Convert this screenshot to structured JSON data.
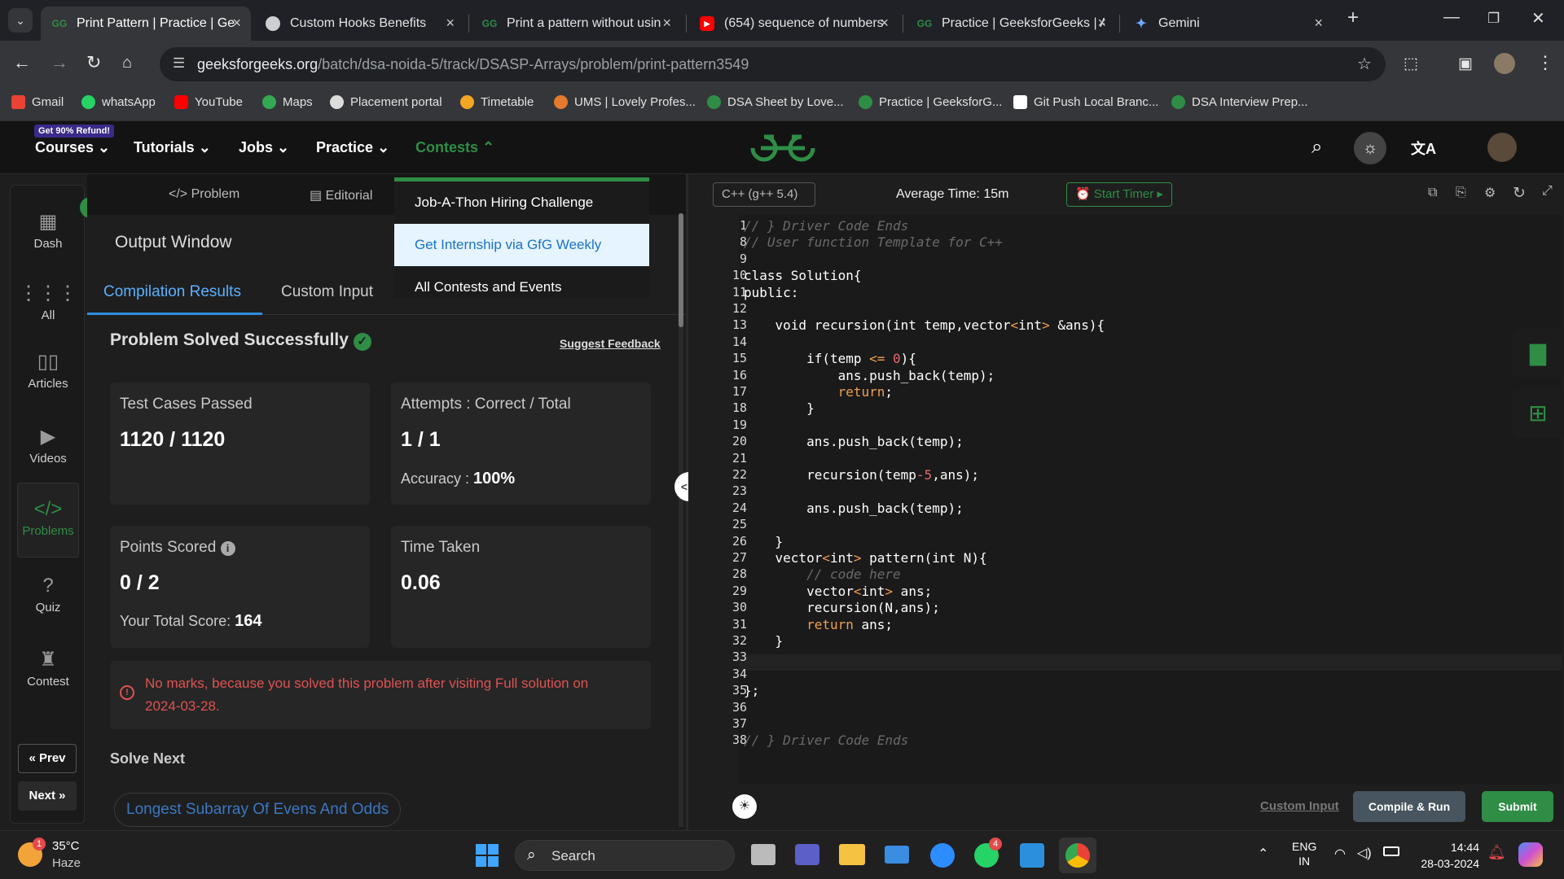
{
  "browser": {
    "tabs": [
      {
        "label": "Print Pattern | Practice | Ge",
        "active": true
      },
      {
        "label": "Custom Hooks Benefits"
      },
      {
        "label": "Print a pattern without usin"
      },
      {
        "label": "(654) sequence of numbers"
      },
      {
        "label": "Practice | GeeksforGeeks | A"
      },
      {
        "label": "Gemini"
      }
    ],
    "url_domain": "geeksforgeeks.org",
    "url_path": "/batch/dsa-noida-5/track/DSASP-Arrays/problem/print-pattern3549",
    "bookmarks": [
      "Gmail",
      "whatsApp",
      "YouTube",
      "Maps",
      "Placement portal",
      "Timetable",
      "UMS | Lovely Profes...",
      "DSA Sheet by Love...",
      "Practice | GeeksforG...",
      "Git Push Local Branc...",
      "DSA Interview Prep..."
    ]
  },
  "nav": {
    "badge": "Get 90% Refund!",
    "items": [
      "Courses",
      "Tutorials",
      "Jobs",
      "Practice",
      "Contests"
    ]
  },
  "rail": {
    "items": [
      "Dash",
      "All",
      "Articles",
      "Videos",
      "Problems",
      "Quiz",
      "Contest"
    ],
    "prev": "Prev",
    "next": "Next"
  },
  "left": {
    "tabs": [
      "Problem",
      "Editorial"
    ],
    "output_title": "Output Window",
    "subtabs": [
      "Compilation Results",
      "Custom Input"
    ],
    "status": "Problem Solved Successfully",
    "feedback": "Suggest Feedback",
    "test_label": "Test Cases Passed",
    "test_value": "1120 / 1120",
    "attempts_label": "Attempts : Correct / Total",
    "attempts_value": "1 / 1",
    "accuracy_label": "Accuracy :",
    "accuracy_value": "100%",
    "points_label": "Points Scored",
    "points_value": "0 / 2",
    "total_label": "Your Total Score:",
    "total_value": "164",
    "time_label": "Time Taken",
    "time_value": "0.06",
    "warning": "No marks, because you solved this problem after visiting Full solution on 2024-03-28.",
    "solve_next": "Solve Next",
    "next_problem": "Longest Subarray Of Evens And Odds"
  },
  "dropdown": [
    "Job-A-Thon Hiring Challenge",
    "Get Internship via GfG Weekly",
    "All Contests and Events"
  ],
  "editor": {
    "language": "C++ (g++ 5.4)",
    "avg_time": "Average Time: 15m",
    "start_timer": "Start Timer",
    "custom_input": "Custom Input",
    "compile": "Compile & Run",
    "submit": "Submit",
    "line_numbers": [
      "1",
      "8",
      "9",
      "10",
      "11",
      "12",
      "13",
      "14",
      "15",
      "16",
      "17",
      "18",
      "19",
      "20",
      "21",
      "22",
      "23",
      "24",
      "25",
      "26",
      "27",
      "28",
      "29",
      "30",
      "31",
      "32",
      "33",
      "34",
      "35",
      "36",
      "37",
      "38"
    ],
    "lines": [
      "// } Driver Code Ends",
      "// User function Template for C++",
      "",
      "class Solution{",
      "public:",
      "",
      "    void recursion(int temp,vector<int> &ans){",
      "",
      "        if(temp <= 0){",
      "            ans.push_back(temp);",
      "            return;",
      "        }",
      "",
      "        ans.push_back(temp);",
      "",
      "        recursion(temp-5,ans);",
      "",
      "        ans.push_back(temp);",
      "",
      "    }",
      "    vector<int> pattern(int N){",
      "        // code here",
      "        vector<int> ans;",
      "        recursion(N,ans);",
      "        return ans;",
      "    }",
      "",
      "",
      "};",
      "",
      "",
      "// } Driver Code Ends"
    ]
  },
  "taskbar": {
    "temp": "35°C",
    "weather": "Haze",
    "search": "Search",
    "lang1": "ENG",
    "lang2": "IN",
    "time": "14:44",
    "date": "28-03-2024",
    "weather_badge": "1",
    "whatsapp_badge": "4"
  },
  "colors": {
    "accent": "#2f8d46",
    "link": "#5bb0ff",
    "error": "#e05252"
  }
}
